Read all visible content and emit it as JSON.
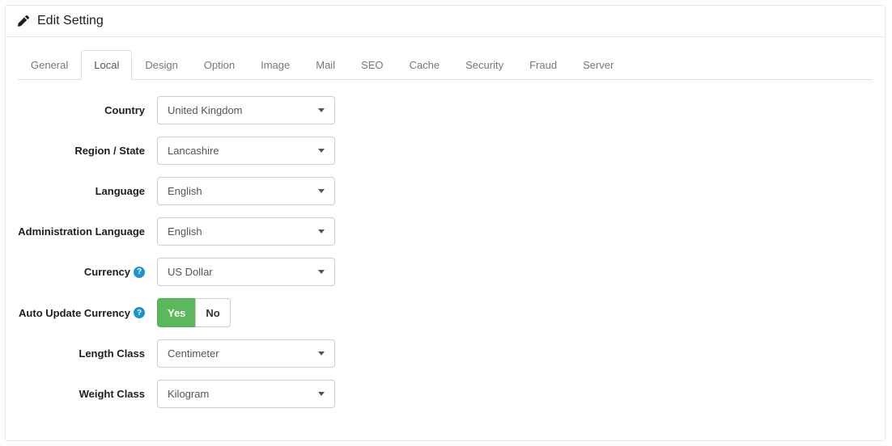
{
  "header": {
    "title": "Edit Setting"
  },
  "tabs": [
    "General",
    "Local",
    "Design",
    "Option",
    "Image",
    "Mail",
    "SEO",
    "Cache",
    "Security",
    "Fraud",
    "Server"
  ],
  "active_tab": "Local",
  "labels": {
    "country": "Country",
    "region": "Region / State",
    "language": "Language",
    "admin_language": "Administration Language",
    "currency": "Currency",
    "auto_update_currency": "Auto Update Currency",
    "length_class": "Length Class",
    "weight_class": "Weight Class"
  },
  "values": {
    "country": "United Kingdom",
    "region": "Lancashire",
    "language": "English",
    "admin_language": "English",
    "currency": "US Dollar",
    "auto_update_currency": "Yes",
    "length_class": "Centimeter",
    "weight_class": "Kilogram"
  },
  "toggle": {
    "yes": "Yes",
    "no": "No"
  },
  "help_glyph": "?",
  "colors": {
    "accent": "#1e91cf",
    "success": "#5cb85c"
  }
}
